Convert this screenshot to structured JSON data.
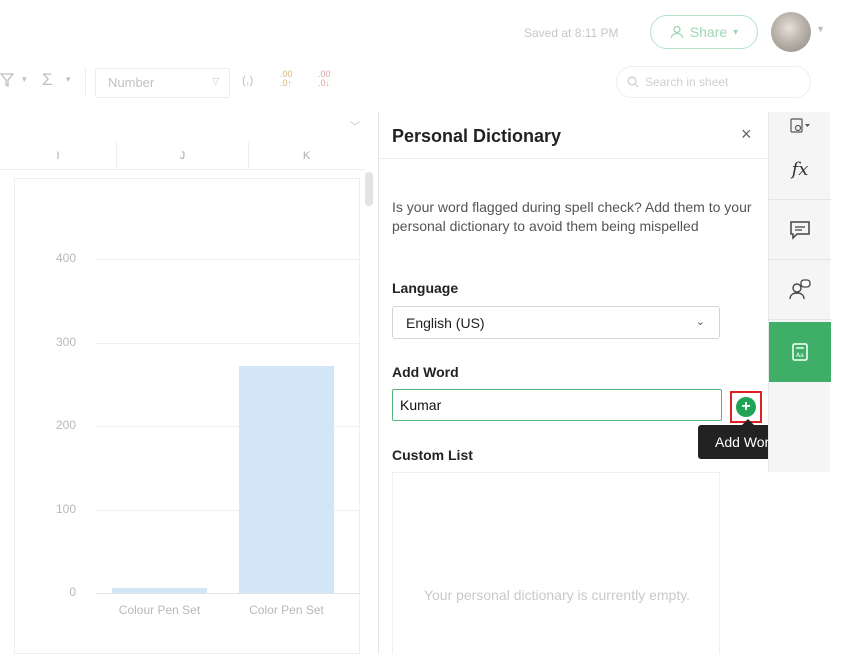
{
  "header": {
    "saved_status": "Saved at 8:11 PM",
    "share_label": "Share"
  },
  "toolbar": {
    "number_format": "Number",
    "search_placeholder": "Search in sheet"
  },
  "columns": [
    "I",
    "J",
    "K"
  ],
  "chart_data": {
    "type": "bar",
    "categories": [
      "Colour Pen Set",
      "Color Pen Set"
    ],
    "values": [
      6,
      272
    ],
    "y_ticks": [
      "0",
      "100",
      "200",
      "300",
      "400"
    ],
    "ylim": [
      0,
      400
    ],
    "bar_color": "#d3e6f7"
  },
  "panel": {
    "title": "Personal Dictionary",
    "close_label": "×",
    "description": "Is your word flagged during spell check? Add them to your personal dictionary to avoid them being mispelled",
    "language_label": "Language",
    "language_value": "English (US)",
    "add_word_label": "Add Word",
    "add_word_value": "Kumar",
    "add_tooltip": "Add Word",
    "custom_list_label": "Custom List",
    "empty_message": "Your personal dictionary is currently empty."
  },
  "rail": {
    "items": [
      "view-settings-icon",
      "function-icon",
      "comment-icon",
      "collaborate-icon",
      "dictionary-icon"
    ]
  },
  "colors": {
    "accent": "#3fae66",
    "highlight": "#e02020"
  }
}
